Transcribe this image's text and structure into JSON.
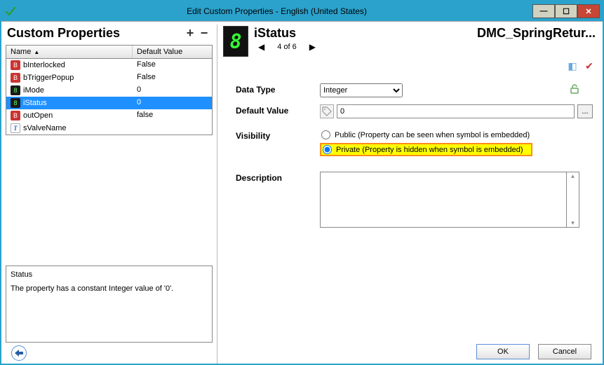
{
  "window": {
    "title": "Edit Custom Properties - English (United States)"
  },
  "left_panel": {
    "title": "Custom Properties",
    "add_label": "+",
    "remove_label": "−",
    "columns": {
      "name": "Name",
      "default": "Default Value"
    },
    "rows": [
      {
        "icon": "bool",
        "name": "bInterlocked",
        "value": "False"
      },
      {
        "icon": "bool",
        "name": "bTriggerPopup",
        "value": "False"
      },
      {
        "icon": "int",
        "name": "iMode",
        "value": "0"
      },
      {
        "icon": "int",
        "name": "iStatus",
        "value": "0",
        "selected": true
      },
      {
        "icon": "bool",
        "name": "outOpen",
        "value": "false"
      },
      {
        "icon": "italic",
        "name": "sValveName",
        "value": ""
      }
    ],
    "status_title": "Status",
    "status_text": "The property has a constant Integer value of '0'."
  },
  "right_panel": {
    "prop_name": "iStatus",
    "pager": {
      "pos": "4 of 6"
    },
    "symbol": "DMC_SpringRetur...",
    "fields": {
      "data_type_label": "Data Type",
      "data_type_value": "Integer",
      "default_value_label": "Default Value",
      "default_value": "0",
      "visibility_label": "Visibility",
      "visibility_public": "Public (Property can be seen when symbol is embedded)",
      "visibility_private": "Private (Property is hidden when symbol is embedded)",
      "description_label": "Description",
      "description_value": ""
    }
  },
  "buttons": {
    "ok": "OK",
    "cancel": "Cancel"
  }
}
